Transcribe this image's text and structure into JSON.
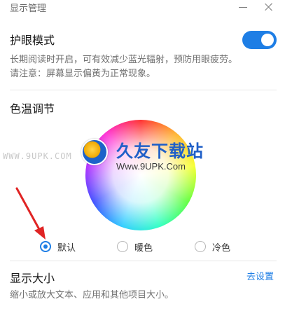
{
  "window": {
    "title": "显示管理"
  },
  "eye_protection": {
    "title": "护眼模式",
    "enabled": true,
    "description_line1": "长期阅读时开启，可有效减少蓝光辐射，预防用眼疲劳。",
    "description_line2": "请注意：屏幕显示偏黄为正常现象。"
  },
  "color_temperature": {
    "title": "色温调节",
    "options": [
      {
        "label": "默认",
        "selected": true
      },
      {
        "label": "暖色",
        "selected": false
      },
      {
        "label": "冷色",
        "selected": false
      }
    ]
  },
  "watermark": {
    "left_text": "WWW.9UPK.COM",
    "title": "久友下载站",
    "sub": "Www.9UPK.Com"
  },
  "display_size": {
    "title": "显示大小",
    "link": "去设置",
    "description": "缩小或放大文本、应用和其他项目大小。"
  },
  "colors": {
    "accent": "#1e7ee5",
    "annotation_arrow": "#e02424"
  }
}
